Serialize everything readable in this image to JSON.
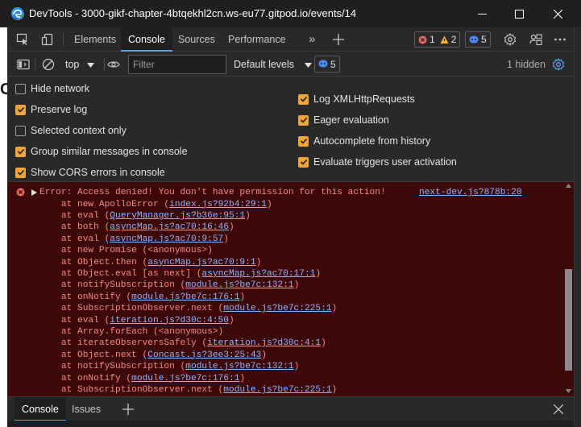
{
  "window": {
    "title": "DevTools - 3000-gikf-chapter-4btqekhl2cn.ws-eu77.gitpod.io/events/14",
    "background_hint": "Ca"
  },
  "main_tabs": {
    "elements": "Elements",
    "console": "Console",
    "sources": "Sources",
    "performance": "Performance",
    "more": "»",
    "errors_count": "1",
    "warnings_count": "2",
    "issues_count": "5"
  },
  "console_toolbar": {
    "context": "top",
    "filter_placeholder": "Filter",
    "levels": "Default levels",
    "issues_count": "5",
    "hidden": "1 hidden"
  },
  "settings": {
    "left": [
      {
        "label": "Hide network",
        "checked": false
      },
      {
        "label": "Preserve log",
        "checked": true
      },
      {
        "label": "Selected context only",
        "checked": false
      },
      {
        "label": "Group similar messages in console",
        "checked": true
      },
      {
        "label": "Show CORS errors in console",
        "checked": true
      }
    ],
    "right": [
      {
        "label": "Log XMLHttpRequests",
        "checked": true
      },
      {
        "label": "Eager evaluation",
        "checked": true
      },
      {
        "label": "Autocomplete from history",
        "checked": true
      },
      {
        "label": "Evaluate triggers user activation",
        "checked": true
      }
    ]
  },
  "error": {
    "message": "Error: Access denied! You don't have permission for this action!",
    "source": "next-dev.js?878b:20",
    "stack": [
      {
        "prefix": "    at new ApolloError (",
        "link": "index.js?92b4:29:1",
        "suffix": ")"
      },
      {
        "prefix": "    at eval (",
        "link": "QueryManager.js?b36e:95:1",
        "suffix": ")"
      },
      {
        "prefix": "    at both (",
        "link": "asyncMap.js?ac70:16:46",
        "suffix": ")"
      },
      {
        "prefix": "    at eval (",
        "link": "asyncMap.js?ac70:9:57",
        "suffix": ")"
      },
      {
        "prefix": "    at new Promise (<anonymous>)",
        "link": "",
        "suffix": ""
      },
      {
        "prefix": "    at Object.then (",
        "link": "asyncMap.js?ac70:9:1",
        "suffix": ")"
      },
      {
        "prefix": "    at Object.eval [as next] (",
        "link": "asyncMap.js?ac70:17:1",
        "suffix": ")"
      },
      {
        "prefix": "    at notifySubscription (",
        "link": "module.js?be7c:132:1",
        "suffix": ")"
      },
      {
        "prefix": "    at onNotify (",
        "link": "module.js?be7c:176:1",
        "suffix": ")"
      },
      {
        "prefix": "    at SubscriptionObserver.next (",
        "link": "module.js?be7c:225:1",
        "suffix": ")"
      },
      {
        "prefix": "    at eval (",
        "link": "iteration.js?d30c:4:50",
        "suffix": ")"
      },
      {
        "prefix": "    at Array.forEach (<anonymous>)",
        "link": "",
        "suffix": ""
      },
      {
        "prefix": "    at iterateObserversSafely (",
        "link": "iteration.js?d30c:4:1",
        "suffix": ")"
      },
      {
        "prefix": "    at Object.next (",
        "link": "Concast.js?3ee3:25:43",
        "suffix": ")"
      },
      {
        "prefix": "    at notifySubscription (",
        "link": "module.js?be7c:132:1",
        "suffix": ")"
      },
      {
        "prefix": "    at onNotify (",
        "link": "module.js?be7c:176:1",
        "suffix": ")"
      },
      {
        "prefix": "    at SubscriptionObserver.next (",
        "link": "module.js?be7c:225:1",
        "suffix": ")"
      }
    ]
  },
  "drawer": {
    "console": "Console",
    "issues": "Issues"
  },
  "colors": {
    "accent": "#4fa6ff",
    "checkbox": "#f0a43a",
    "error_bg": "#3d0808",
    "error_text": "#f28b82",
    "link": "#93b4ff"
  },
  "icons": [
    "edge-icon",
    "minimize-icon",
    "maximize-icon",
    "close-icon",
    "inspect-icon",
    "device-icon",
    "plus-icon",
    "gear-icon",
    "connect-icon",
    "more-icon",
    "sidebar-icon",
    "clear-icon",
    "eye-icon",
    "caret-down-icon",
    "error-circle-icon",
    "warning-triangle-icon",
    "issues-icon",
    "expand-arrow-icon"
  ]
}
